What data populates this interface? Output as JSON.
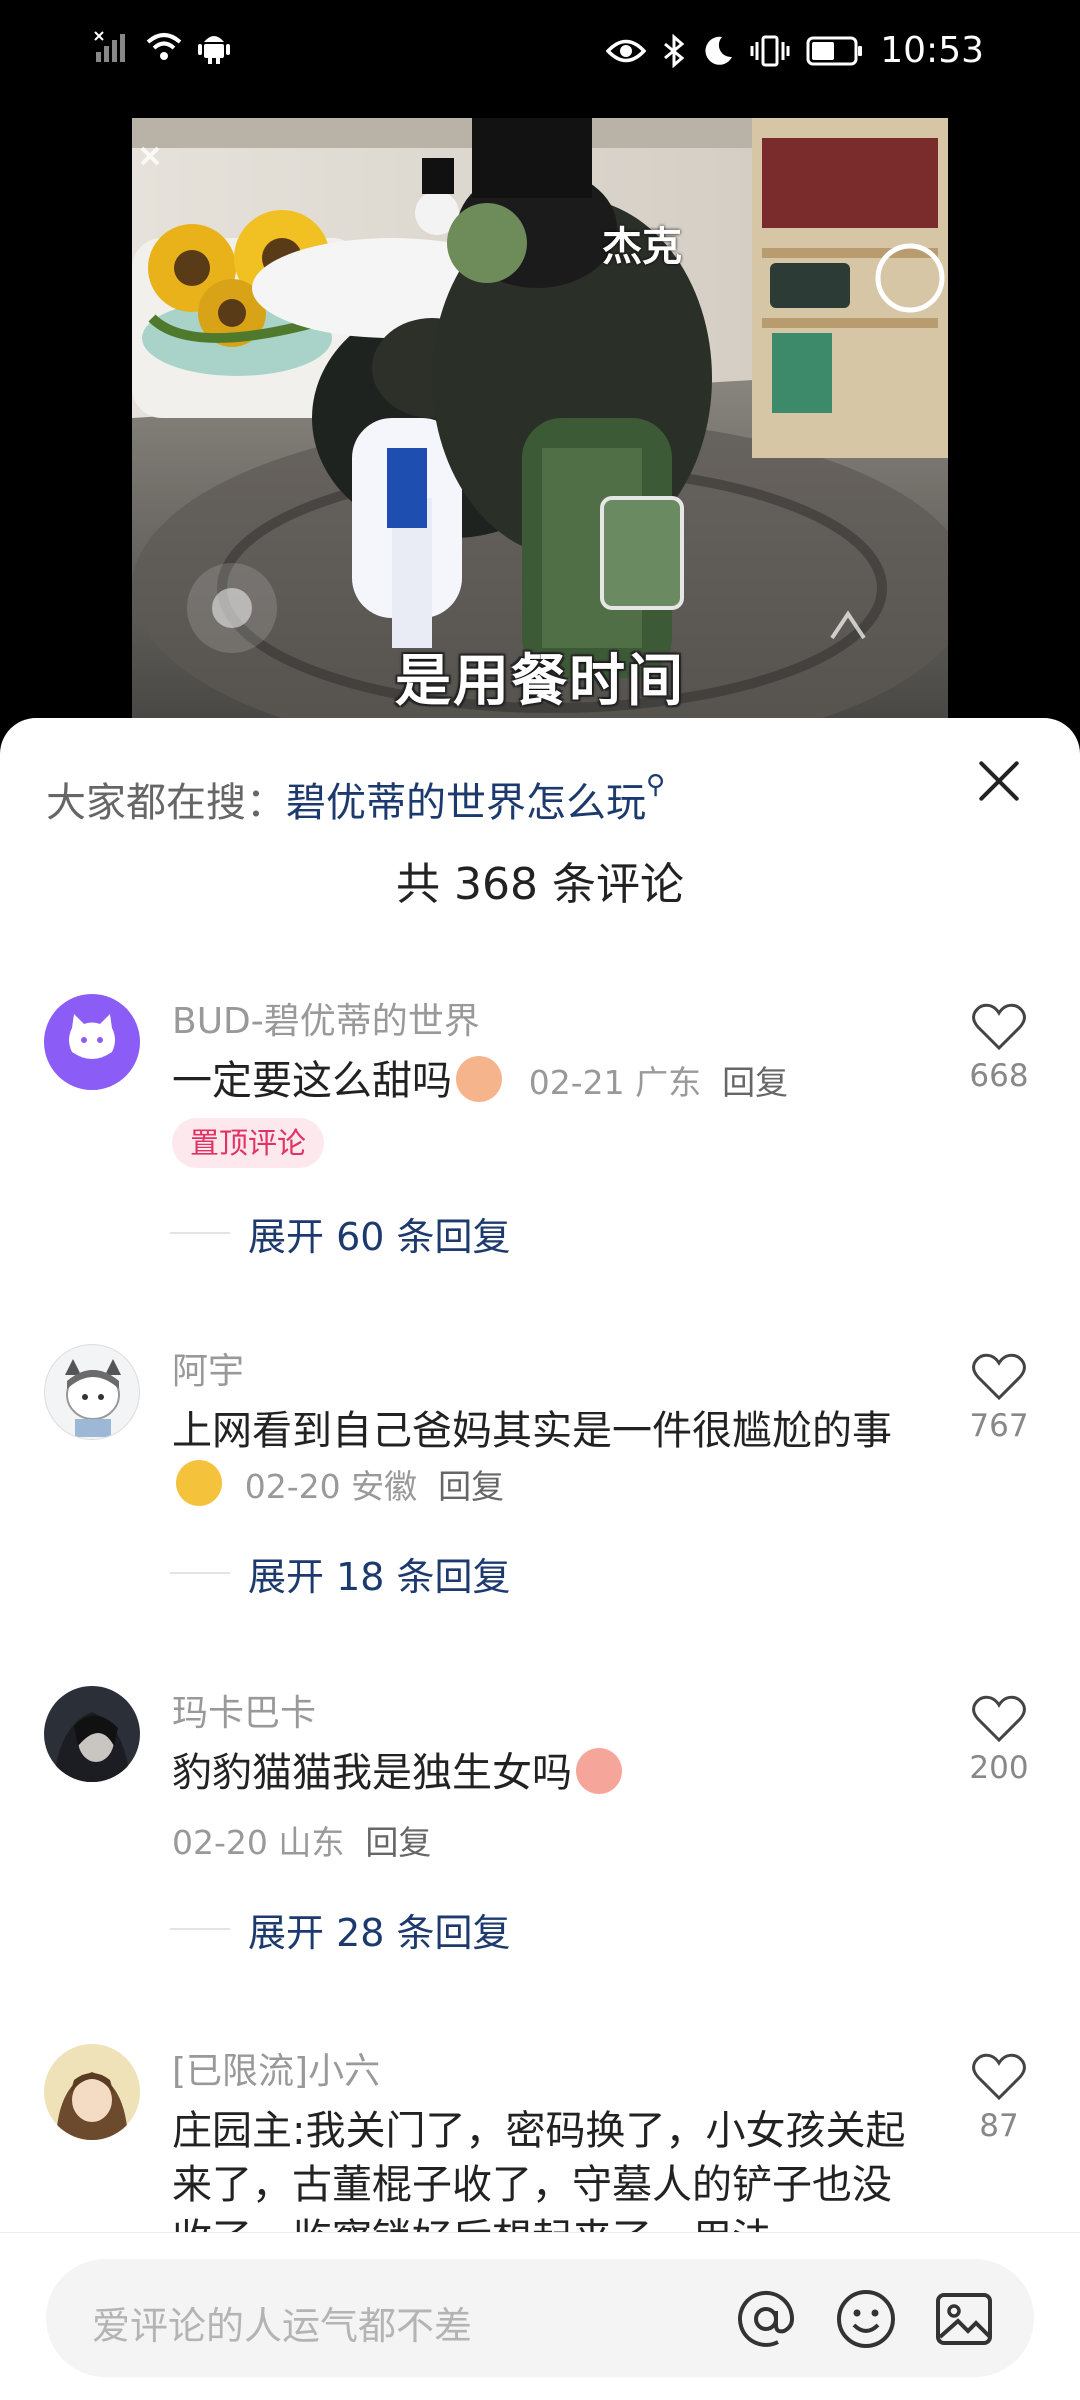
{
  "status_bar": {
    "time": "10:53",
    "battery_level": 0.55,
    "icons": [
      "signal-icon",
      "wifi-icon",
      "android-icon",
      "eye-icon",
      "bluetooth-icon",
      "moon-icon",
      "vibrate-icon",
      "battery-icon"
    ]
  },
  "video": {
    "subtitle": "是用餐时间",
    "top_caption": "杰克"
  },
  "sheet": {
    "search_prefix": "大家都在搜：",
    "search_keyword": "碧优蒂的世界怎么玩",
    "comment_count": "共 368 条评论"
  },
  "comments": [
    {
      "user": "BUD-碧优蒂的世界",
      "text": "一定要这么甜吗",
      "date": "02-21",
      "location": "广东",
      "reply": "回复",
      "pinned_label": "置顶评论",
      "expand": "展开 60 条回复",
      "likes": "668"
    },
    {
      "user": "阿宇",
      "text": "上网看到自己爸妈其实是一件很尴尬的事",
      "date": "02-20",
      "location": "安徽",
      "reply": "回复",
      "expand": "展开 18 条回复",
      "likes": "767"
    },
    {
      "user": "玛卡巴卡",
      "text": "豹豹猫猫我是独生女吗",
      "date": "02-20",
      "location": "山东",
      "reply": "回复",
      "expand": "展开 28 条回复",
      "likes": "200"
    },
    {
      "user": "[已限流]小六",
      "text": "庄园主:我关门了，密码换了，小女孩关起来了，古董棍子收了，守墓人的铲子也没收了，监察锁好后想起来了，用法",
      "likes": "87"
    }
  ],
  "input": {
    "placeholder": "爱评论的人运气都不差",
    "icons": [
      "at-icon",
      "emoji-icon",
      "image-icon"
    ]
  },
  "colors": {
    "keyword_blue": "#1d3a6e",
    "pin_text": "#e03364",
    "pin_bg": "#fde8ee",
    "avatar_purple": "#8b5cf6"
  }
}
